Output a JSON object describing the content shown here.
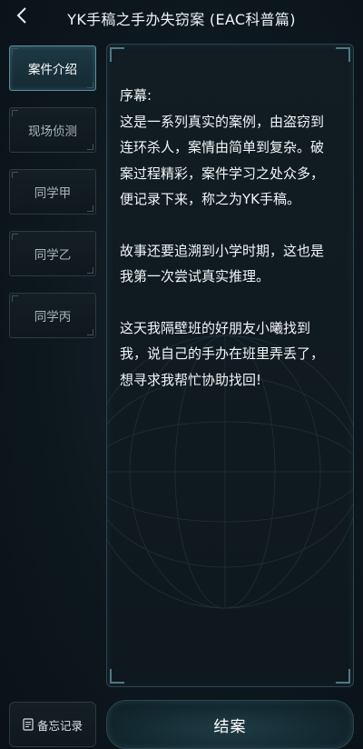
{
  "header": {
    "title": "YK手稿之手办失窃案 (EAC科普篇)"
  },
  "sidebar": {
    "tabs": [
      {
        "label": "案件介绍",
        "active": true
      },
      {
        "label": "现场侦测",
        "active": false
      },
      {
        "label": "同学甲",
        "active": false
      },
      {
        "label": "同学乙",
        "active": false
      },
      {
        "label": "同学丙",
        "active": false
      }
    ]
  },
  "content": {
    "paragraphs": [
      [
        "序幕:",
        "这是一系列真实的案例，由盗窃到",
        "连环杀人，案情由简单到复杂。破",
        "案过程精彩，案件学习之处众多，",
        "便记录下来，称之为YK手稿。"
      ],
      [
        "故事还要追溯到小学时期，这也是",
        "我第一次尝试真实推理。"
      ],
      [
        "这天我隔壁班的好朋友小曦找到",
        "我，说自己的手办在班里弄丢了，",
        "想寻求我帮忙协助找回!"
      ]
    ]
  },
  "footer": {
    "memo_label": "备忘记录",
    "close_label": "结案"
  },
  "icons": {
    "back": "chevron-left-icon",
    "memo": "notepad-icon"
  }
}
